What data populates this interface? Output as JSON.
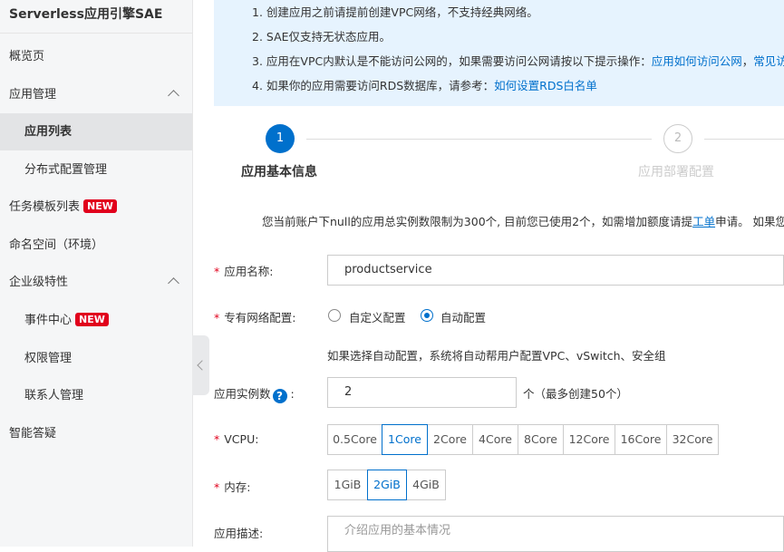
{
  "sidebar": {
    "title": "Serverless应用引擎SAE",
    "items": [
      {
        "label": "概览页"
      },
      {
        "label": "应用管理"
      },
      {
        "label": "应用列表"
      },
      {
        "label": "分布式配置管理"
      },
      {
        "label": "任务模板列表",
        "badge": "NEW"
      },
      {
        "label": "命名空间（环境）"
      },
      {
        "label": "企业级特性"
      },
      {
        "label": "事件中心",
        "badge": "NEW"
      },
      {
        "label": "权限管理"
      },
      {
        "label": "联系人管理"
      },
      {
        "label": "智能答疑"
      }
    ]
  },
  "notice": {
    "line1": "1. 创建应用之前请提前创建VPC网络，不支持经典网络。",
    "line2": "2. SAE仅支持无状态应用。",
    "line3_prefix": "3. 应用在VPC内默认是不能访问公网的，如果需要访问公网请按以下提示操作：",
    "line3_link1": "应用如何访问公网",
    "line3_sep": "，",
    "line3_link2": "常见访问",
    "line4_prefix": "4. 如果你的应用需要访问RDS数据库，请参考：",
    "line4_link": "如何设置RDS白名单"
  },
  "steps": [
    {
      "number": "1",
      "title": "应用基本信息"
    },
    {
      "number": "2",
      "title": "应用部署配置"
    }
  ],
  "quota": {
    "prefix": "您当前账户下null的应用总实例数限制为300个, 目前您已使用2个，如需增加额度请提",
    "link": "工单",
    "suffix": "申请。 如果您的"
  },
  "form": {
    "required_mark": "*",
    "name_label": "应用名称:",
    "name_value": "productservice",
    "vpc_label": "专有网络配置:",
    "vpc_options": [
      "自定义配置",
      "自动配置"
    ],
    "vpc_selected": "自动配置",
    "vpc_hint": "如果选择自动配置，系统将自动帮用户配置VPC、vSwitch、安全组",
    "instances_label": "应用实例数",
    "instances_help": "?",
    "instances_colon": ":",
    "instances_value": "2",
    "instances_unit": "个（最多创建50个）",
    "vcpu_label": "VCPU:",
    "vcpu_options": [
      "0.5Core",
      "1Core",
      "2Core",
      "4Core",
      "8Core",
      "12Core",
      "16Core",
      "32Core"
    ],
    "vcpu_selected": "1Core",
    "memory_label": "内存:",
    "memory_options": [
      "1GiB",
      "2GiB",
      "4GiB"
    ],
    "memory_selected": "2GiB",
    "desc_label": "应用描述:",
    "desc_placeholder": "介绍应用的基本情况"
  },
  "colors": {
    "accent": "#0070cc",
    "badge": "#e1001c",
    "notice_bg": "#e6f3fe",
    "sidebar_bg": "#f5f6f7"
  }
}
